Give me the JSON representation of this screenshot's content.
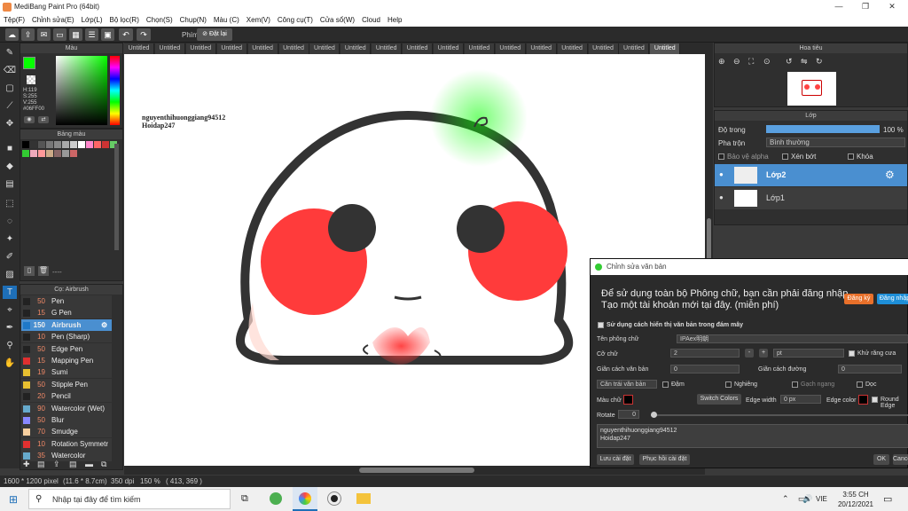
{
  "app": {
    "title": "MediBang Paint Pro (64bit)"
  },
  "menu": [
    "Tệp(F)",
    "Chỉnh sửa(E)",
    "Lớp(L)",
    "Bộ lọc(R)",
    "Chọn(S)",
    "Chụp(N)",
    "Màu (C)",
    "Xem(V)",
    "Công cụ(T)",
    "Cửa sổ(W)",
    "Cloud",
    "Help"
  ],
  "toolbar": {
    "phim": "Phím",
    "reset": "Đặt lại"
  },
  "color_panel": {
    "title": "Màu",
    "h": "H:119",
    "s": "S:255",
    "v": "V:255",
    "hex": "#06FF00",
    "fg": "#06ff00"
  },
  "palette_panel": {
    "title": "Bảng màu",
    "dashes": "----"
  },
  "brush_panel": {
    "title": "Cọ: Airbrush",
    "items": [
      {
        "size": "50",
        "name": "Pen",
        "color": "#222222"
      },
      {
        "size": "15",
        "name": "G Pen",
        "color": "#222222"
      },
      {
        "size": "150",
        "name": "Airbrush",
        "color": "#1e78c8"
      },
      {
        "size": "10",
        "name": "Pen (Sharp)",
        "color": "#222222"
      },
      {
        "size": "50",
        "name": "Edge Pen",
        "color": "#222222"
      },
      {
        "size": "15",
        "name": "Mapping Pen",
        "color": "#e03030"
      },
      {
        "size": "19",
        "name": "Sumi",
        "color": "#e8c030"
      },
      {
        "size": "50",
        "name": "Stipple Pen",
        "color": "#e8c030"
      },
      {
        "size": "20",
        "name": "Pencil",
        "color": "#222222"
      },
      {
        "size": "90",
        "name": "Watercolor (Wet)",
        "color": "#6ac"
      },
      {
        "size": "50",
        "name": "Blur",
        "color": "#88f"
      },
      {
        "size": "70",
        "name": "Smudge",
        "color": "#f8d0a0"
      },
      {
        "size": "10",
        "name": "Rotation Symmetr",
        "color": "#e03030"
      },
      {
        "size": "35",
        "name": "Watercolor",
        "color": "#6ac"
      }
    ]
  },
  "tabs": [
    "Untitled",
    "Untitled",
    "Untitled",
    "Untitled",
    "Untitled",
    "Untitled",
    "Untitled",
    "Untitled",
    "Untitled",
    "Untitled",
    "Untitled",
    "Untitled",
    "Untitled",
    "Untitled",
    "Untitled",
    "Untitled",
    "Untitled",
    "Untitled"
  ],
  "canvas": {
    "watermark1": "nguyenthihuonggiang94512",
    "watermark2": "Hoidap247"
  },
  "navigator": {
    "title": "Hoa tiêu"
  },
  "layer_panel": {
    "title": "Lớp",
    "opacity_label": "Độ trong",
    "opacity_value": "100 %",
    "blend_label": "Pha trộn",
    "blend_value": "Bình thường",
    "protect_alpha": "Bảo vệ alpha",
    "clip": "Xén bớt",
    "lock": "Khóa",
    "layers": [
      {
        "name": "Lớp2"
      },
      {
        "name": "Lớp1"
      }
    ]
  },
  "dialog": {
    "title": "Chỉnh sửa văn bản",
    "notice1": "Để sử dụng toàn bộ Phông chữ, bạn cần phải đăng nhập.",
    "notice2": "Tạo một tài khoản mới tại đây. (miễn phí)",
    "register": "Đăng ký",
    "login": "Đăng nhập",
    "use_rich": "Sử dụng cách hiển thị văn bản trong đám mây",
    "font_label": "Tên phông chữ",
    "font_value": "IPAex明朝",
    "size_label": "Cỡ chữ",
    "size_value": "2",
    "unit": "pt",
    "antialias": "Khử răng cưa",
    "char_spacing": "Giãn cách văn bản",
    "char_spacing_value": "0",
    "line_spacing": "Giãn cách đường",
    "line_spacing_value": "0",
    "align": "Căn trái văn bản",
    "bold": "Đậm",
    "italic": "Nghiêng",
    "underline": "Gạch ngang",
    "vertical": "Dọc",
    "color_label": "Màu chữ",
    "switch_colors": "Switch Colors",
    "edge_width": "Edge width",
    "edge_value": "0 px",
    "edge_color": "Edge color",
    "round_edge": "Round Edge",
    "rotate": "Rotate",
    "rotate_value": "0",
    "text": "nguyenthihuonggiang94512\nHoidap247",
    "save": "Lưu cài đặt",
    "restore": "Phục hồi cài đặt",
    "ok": "OK",
    "cancel": "Cancel"
  },
  "status": {
    "pixels": "1600 * 1200 pixel",
    "cm": "(11.6 * 8.7cm)",
    "dpi": "350 dpi",
    "zoom": "150 %",
    "coords": "( 413, 369 )"
  },
  "taskbar": {
    "search": "Nhập tại đây để tìm kiếm",
    "lang": "VIE",
    "time": "3:55 CH",
    "date": "20/12/2021"
  }
}
